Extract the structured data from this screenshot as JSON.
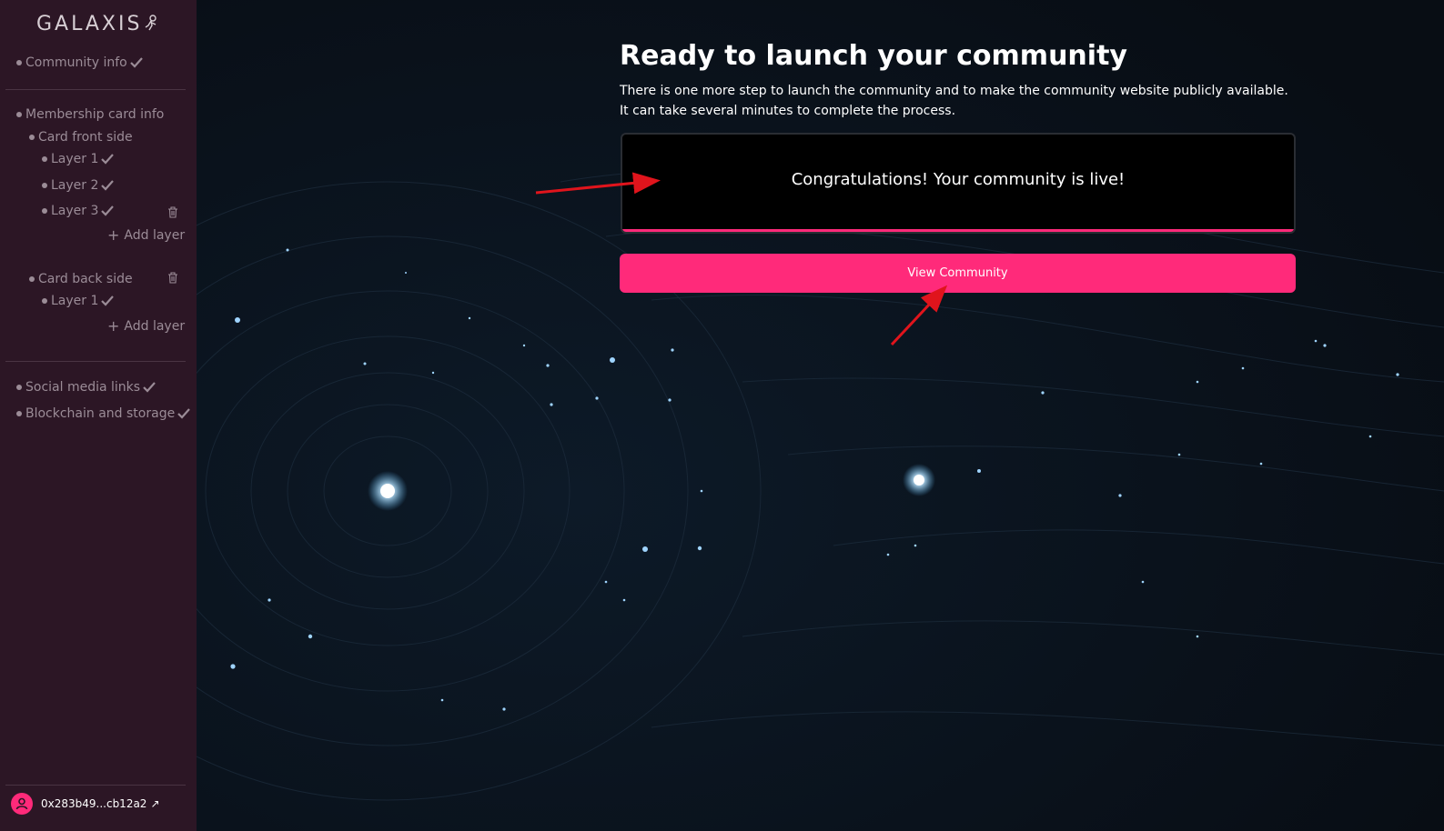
{
  "sidebar": {
    "logo": "GALAXIS",
    "logo_icon": "astronaut-icon",
    "sections": {
      "community_info": "Community info",
      "membership_card_info": "Membership card info",
      "card_front_side": "Card front side",
      "front_layers": [
        "Layer 1",
        "Layer 2",
        "Layer 3"
      ],
      "card_back_side": "Card back side",
      "back_layers": [
        "Layer 1"
      ],
      "add_layer": "Add layer",
      "social_media_links": "Social media links",
      "blockchain_and_storage": "Blockchain and storage"
    },
    "wallet": {
      "address": "0x283b49...cb12a2",
      "icon": "user-icon",
      "link_icon": "external-link-icon"
    }
  },
  "main": {
    "title": "Ready to launch your community",
    "description_line1": "There is one more step to launch the community and to make the community website publicly available.",
    "description_line2": "It can take several minutes to complete the process.",
    "status_message": "Congratulations! Your community is live!",
    "progress": 1.0,
    "view_button": "View Community"
  },
  "colors": {
    "sidebar_bg": "#2c1625",
    "accent": "#ff2a7a",
    "main_bg": "#0a0f17",
    "annotation_arrow": "#e0141c"
  }
}
